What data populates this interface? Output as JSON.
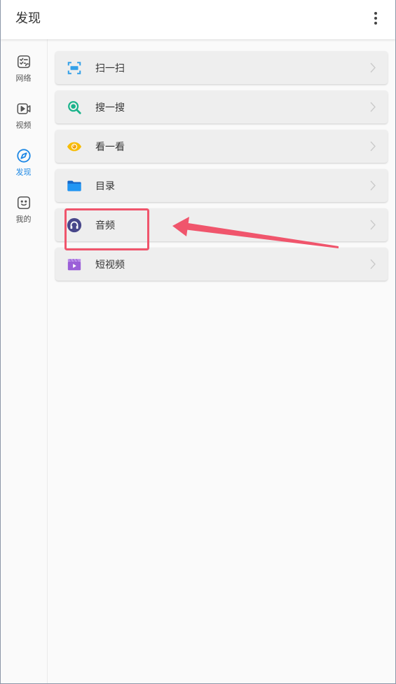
{
  "header": {
    "title": "发现",
    "menu_icon": "more-vert-icon"
  },
  "sidebar": {
    "items": [
      {
        "label": "网络",
        "icon": "checklist-icon",
        "active": false
      },
      {
        "label": "视频",
        "icon": "video-icon",
        "active": false
      },
      {
        "label": "发现",
        "icon": "compass-icon",
        "active": true
      },
      {
        "label": "我的",
        "icon": "smiley-icon",
        "active": false
      }
    ]
  },
  "main": {
    "groups": [
      {
        "items": [
          {
            "label": "扫一扫",
            "icon": "scan-icon"
          },
          {
            "label": "搜一搜",
            "icon": "search-icon"
          },
          {
            "label": "看一看",
            "icon": "eye-icon"
          }
        ]
      },
      {
        "items": [
          {
            "label": "目录",
            "icon": "folder-icon"
          },
          {
            "label": "音频",
            "icon": "headphones-icon",
            "highlighted": true
          },
          {
            "label": "短视频",
            "icon": "short-video-icon"
          }
        ]
      }
    ]
  },
  "colors": {
    "accent": "#1e88e5",
    "annotation": "#f0556c",
    "card_background": "#eeeeee",
    "text": "#333333"
  }
}
